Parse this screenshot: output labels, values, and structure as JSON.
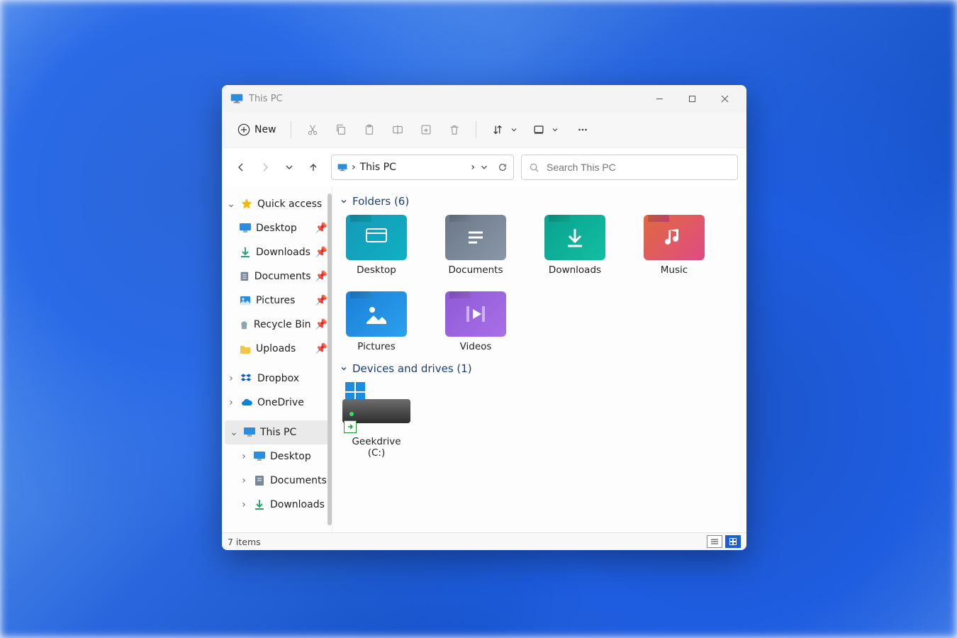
{
  "window": {
    "title": "This PC"
  },
  "toolbar": {
    "new_label": "New"
  },
  "address": {
    "location": "This PC"
  },
  "search": {
    "placeholder": "Search This PC"
  },
  "sidebar": {
    "quick_access": "Quick access",
    "qa_items": [
      "Desktop",
      "Downloads",
      "Documents",
      "Pictures",
      "Recycle Bin",
      "Uploads"
    ],
    "dropbox": "Dropbox",
    "onedrive": "OneDrive",
    "this_pc": "This PC",
    "pc_items": [
      "Desktop",
      "Documents",
      "Downloads"
    ]
  },
  "sections": {
    "folders_label": "Folders (6)",
    "drives_label": "Devices and drives (1)"
  },
  "folders": [
    "Desktop",
    "Documents",
    "Downloads",
    "Music",
    "Pictures",
    "Videos"
  ],
  "drives": [
    "Geekdrive (C:)"
  ],
  "status": {
    "count": "7 items"
  }
}
